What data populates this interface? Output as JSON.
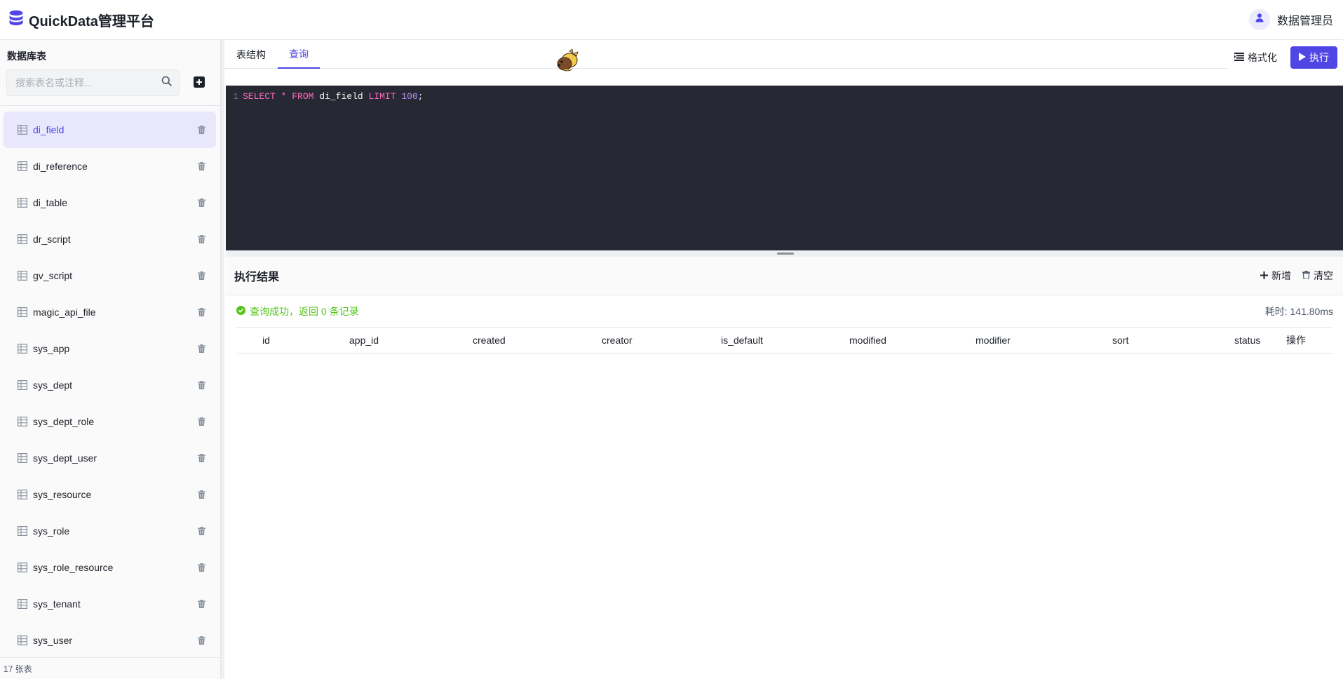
{
  "header": {
    "app_title": "QuickData管理平台",
    "user_name": "数据管理员"
  },
  "sidebar": {
    "title": "数据库表",
    "search_placeholder": "搜索表名或注释...",
    "tables": [
      {
        "name": "di_field",
        "active": true
      },
      {
        "name": "di_reference",
        "active": false
      },
      {
        "name": "di_table",
        "active": false
      },
      {
        "name": "dr_script",
        "active": false
      },
      {
        "name": "gv_script",
        "active": false
      },
      {
        "name": "magic_api_file",
        "active": false
      },
      {
        "name": "sys_app",
        "active": false
      },
      {
        "name": "sys_dept",
        "active": false
      },
      {
        "name": "sys_dept_role",
        "active": false
      },
      {
        "name": "sys_dept_user",
        "active": false
      },
      {
        "name": "sys_resource",
        "active": false
      },
      {
        "name": "sys_role",
        "active": false
      },
      {
        "name": "sys_role_resource",
        "active": false
      },
      {
        "name": "sys_tenant",
        "active": false
      },
      {
        "name": "sys_user",
        "active": false
      }
    ],
    "footer": "17 张表"
  },
  "tabs": [
    {
      "label": "表结构",
      "active": false
    },
    {
      "label": "查询",
      "active": true
    }
  ],
  "toolbar": {
    "format_label": "格式化",
    "execute_label": "执行"
  },
  "editor": {
    "line_number": "1",
    "tokens": {
      "select": "SELECT",
      "star": "*",
      "from": "FROM",
      "table": "di_field",
      "limit": "LIMIT",
      "count": "100",
      "semicolon": ";"
    }
  },
  "results": {
    "title": "执行结果",
    "add_label": "新增",
    "clear_label": "清空",
    "status_message": "查询成功，返回 0 条记录",
    "elapsed": "耗时: 141.80ms",
    "columns": [
      "id",
      "app_id",
      "created",
      "creator",
      "is_default",
      "modified",
      "modifier",
      "sort",
      "status",
      "操作"
    ]
  },
  "colors": {
    "accent": "#4f46e5",
    "success": "#52c41a",
    "editor_bg": "#262833"
  }
}
